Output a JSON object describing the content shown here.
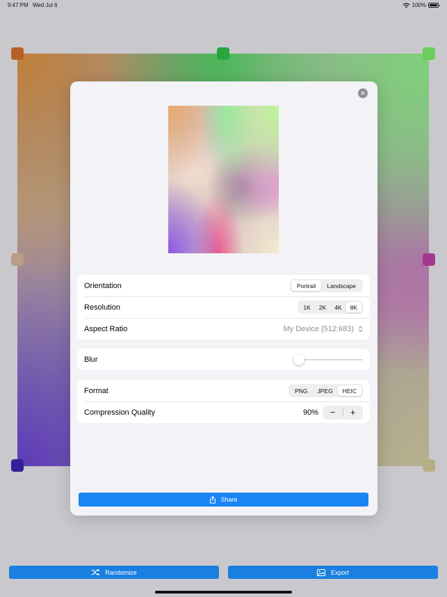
{
  "status_bar": {
    "time": "9:47 PM",
    "date": "Wed Jul 6",
    "battery": "100%",
    "battery_level": 1.0
  },
  "colors": {
    "accent": "#1a84f5",
    "handles": [
      "#b85f26",
      "#2aa53e",
      "#6ccd59",
      "#b99d86",
      "#a3398f",
      "#33209a",
      "#b8ae86"
    ]
  },
  "modal": {
    "close_icon": "close-icon",
    "settings": {
      "orientation": {
        "label": "Orientation",
        "options": [
          "Portrait",
          "Landscape"
        ],
        "selected": "Portrait"
      },
      "resolution": {
        "label": "Resolution",
        "options": [
          "1K",
          "2K",
          "4K",
          "8K"
        ],
        "selected": "8K"
      },
      "aspect_ratio": {
        "label": "Aspect Ratio",
        "value": "My Device (512:683)"
      },
      "blur": {
        "label": "Blur",
        "level": 0
      },
      "format": {
        "label": "Format",
        "options": [
          "PNG",
          "JPEG",
          "HEIC"
        ],
        "selected": "HEIC"
      },
      "compression": {
        "label": "Compression Quality",
        "value": "90%",
        "decrement": "−",
        "increment": "+"
      }
    },
    "share_button": {
      "label": "Share",
      "icon": "share-icon"
    }
  },
  "toolbar": {
    "randomize": {
      "label": "Randomize",
      "icon": "shuffle-icon"
    },
    "export": {
      "label": "Export",
      "icon": "image-icon"
    }
  }
}
